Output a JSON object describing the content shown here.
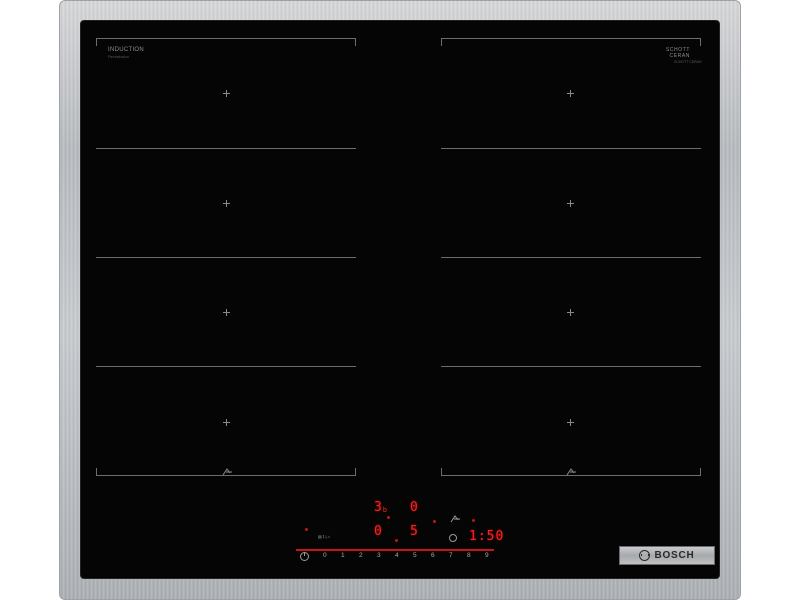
{
  "hob": {
    "left_brand": "INDUCTION",
    "left_brand_sub": "FlexInduction",
    "right_brand_line1": "SCHOTT",
    "right_brand_line2": "CERAN",
    "right_brand_sub": "SCHOTT CERAN"
  },
  "controls": {
    "display_top_left": "3",
    "display_top_left_sub": "b",
    "display_top_right": "0",
    "display_mid_left": "0",
    "display_mid_right": "5",
    "timer": "1:50",
    "slider_numbers": [
      "0",
      "1",
      "2",
      "3",
      "4",
      "5",
      "6",
      "7",
      "8",
      "9"
    ]
  },
  "badge": {
    "brand": "BOSCH"
  },
  "colors": {
    "glass": "#050505",
    "display_red": "#ff1f1f",
    "frame": "#c0c3c6"
  }
}
